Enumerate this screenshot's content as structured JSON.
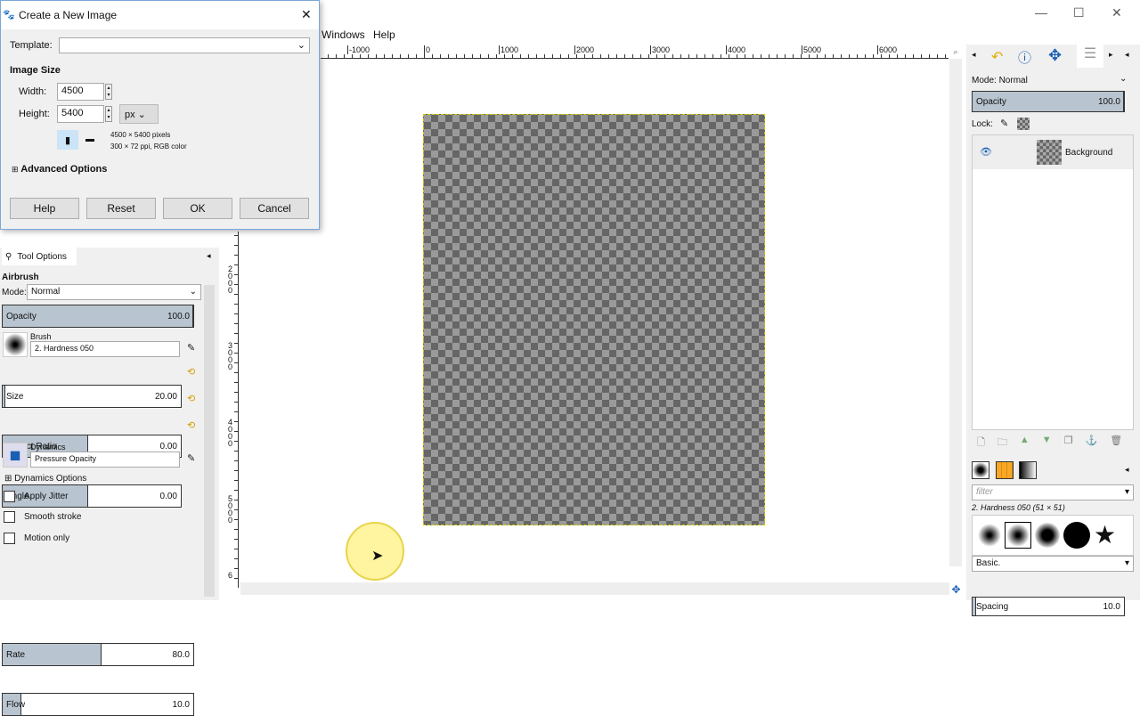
{
  "menu": {
    "windows": "Windows",
    "help": "Help"
  },
  "ruler": {
    "h_ticks": [
      "-1000",
      "0",
      "1000",
      "2000",
      "3000",
      "4000",
      "5000",
      "6000"
    ],
    "v_ticks": [
      "2000",
      "3000",
      "4000",
      "5000",
      "6"
    ]
  },
  "dialog": {
    "title": "Create a New Image",
    "template_label": "Template:",
    "template_value": "",
    "image_size": "Image Size",
    "width_label": "Width:",
    "width_value": "4500",
    "height_label": "Height:",
    "height_value": "5400",
    "unit": "px",
    "info_pixels": "4500 × 5400 pixels",
    "info_res": "300 × 72 ppi, RGB color",
    "advanced": "Advanced Options",
    "help": "Help",
    "reset": "Reset",
    "ok": "OK",
    "cancel": "Cancel"
  },
  "tool_options": {
    "tab": "Tool Options",
    "tool": "Airbrush",
    "mode_label": "Mode:",
    "mode": "Normal",
    "opacity_label": "Opacity",
    "opacity": "100.0",
    "opacity_pct": 100,
    "brush_label": "Brush",
    "brush": "2. Hardness 050",
    "size_label": "Size",
    "size": "20.00",
    "aspect_label": "Aspect Ratio",
    "aspect": "0.00",
    "angle_label": "Angle",
    "angle": "0.00",
    "dynamics_label": "Dynamics",
    "dynamics": "Pressure Opacity",
    "dynamics_options": "Dynamics Options",
    "apply_jitter": "Apply Jitter",
    "smooth_stroke": "Smooth stroke",
    "motion_only": "Motion only",
    "rate_label": "Rate",
    "rate": "80.0",
    "flow_label": "Flow",
    "flow": "10.0"
  },
  "layers": {
    "mode_label": "Mode:",
    "mode": "Normal",
    "opacity_label": "Opacity",
    "opacity": "100.0",
    "lock_label": "Lock:",
    "layer_name": "Background"
  },
  "brushes": {
    "filter_placeholder": "filter",
    "selected": "2. Hardness 050 (51 × 51)",
    "set": "Basic.",
    "spacing_label": "Spacing",
    "spacing": "10.0"
  }
}
